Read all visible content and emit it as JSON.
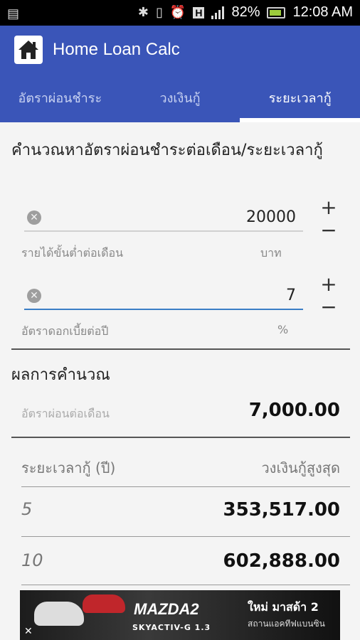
{
  "status": {
    "battery_percent": "82%",
    "time": "12:08 AM"
  },
  "app": {
    "title": "Home Loan Calc",
    "colors": {
      "primary": "#3a55b8",
      "accent": "#3a7ec6"
    }
  },
  "tabs": [
    {
      "label": "อัตราผ่อนชำระ",
      "active": false
    },
    {
      "label": "วงเงินกู้",
      "active": false
    },
    {
      "label": "ระยะเวลากู้",
      "active": true
    }
  ],
  "form": {
    "title": "คำนวณหาอัตราผ่อนชำระต่อเดือน/ระยะเวลากู้",
    "income": {
      "value": "20000",
      "label": "รายได้ขั้นต่ำต่อเดือน",
      "unit": "บาท"
    },
    "interest": {
      "value": "7",
      "label": "อัตราดอกเบี้ยต่อปี",
      "unit": "%"
    },
    "plus": "+",
    "minus": "−"
  },
  "result": {
    "title": "ผลการคำนวณ",
    "monthly_label": "อัตราผ่อนต่อเดือน",
    "monthly_value": "7,000.00",
    "col_period": "ระยะเวลากู้ (ปี)",
    "col_limit": "วงเงินกู้สูงสุด",
    "rows": [
      {
        "years": "5",
        "amount": "353,517.00"
      },
      {
        "years": "10",
        "amount": "602,888.00"
      }
    ]
  },
  "ad": {
    "brand": "MAZDA2",
    "tagline": "SKYACTIV-G 1.3",
    "headline": "ใหม่ มาสด้า 2",
    "sub": "สถานแอคทีฟแบนซิน",
    "close": "✕"
  }
}
